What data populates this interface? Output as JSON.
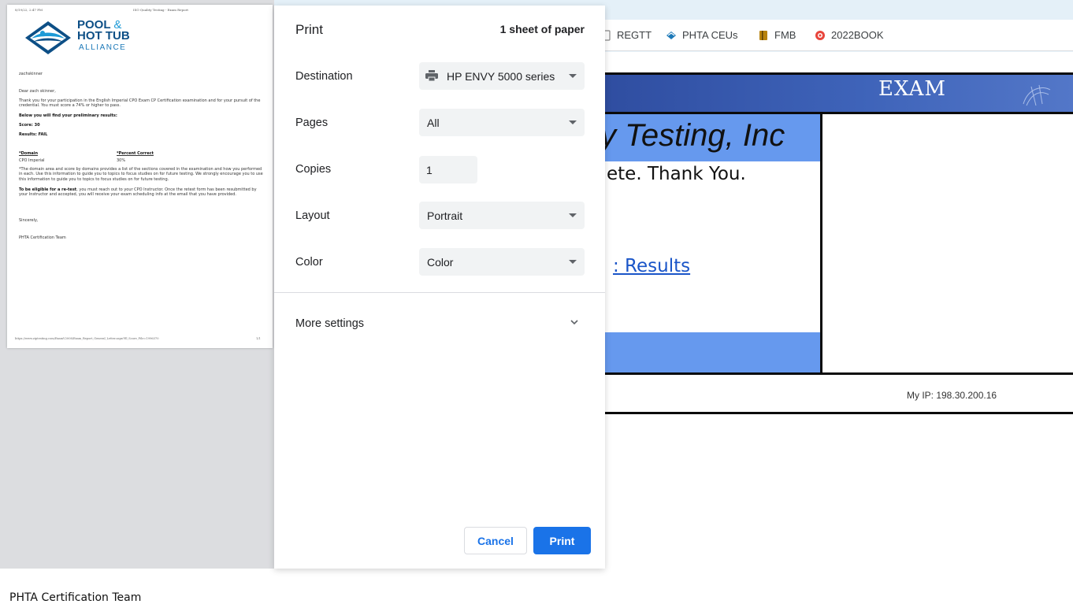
{
  "bookmarks": [
    {
      "label": "REGTT",
      "icon": "document-icon"
    },
    {
      "label": "PHTA CEUs",
      "icon": "phta-logo-icon"
    },
    {
      "label": "FMB",
      "icon": "book-icon"
    },
    {
      "label": "2022BOOK",
      "icon": "circle-logo-icon"
    }
  ],
  "background_page": {
    "exam_header": "EXAM",
    "testing_text": "y Testing, Inc",
    "thanks_text": "ete. Thank You.",
    "results_link": ": Results",
    "my_ip": "My IP: 198.30.200.16"
  },
  "print_dialog": {
    "title": "Print",
    "sheets": "1 sheet of paper",
    "destination": {
      "label": "Destination",
      "value": "HP ENVY 5000 series"
    },
    "pages": {
      "label": "Pages",
      "value": "All"
    },
    "copies": {
      "label": "Copies",
      "value": "1"
    },
    "layout": {
      "label": "Layout",
      "value": "Portrait"
    },
    "color": {
      "label": "Color",
      "value": "Color"
    },
    "more_settings": "More settings",
    "cancel_label": "Cancel",
    "print_label": "Print"
  },
  "preview_doc": {
    "header_left": "8/19/22, 2:47 PM",
    "header_center": "ISO Quality Testing - Exam Report",
    "logo": {
      "line1": "POOL",
      "amp": "&",
      "line2": "HOT TUB",
      "line3": "ALLIANCE"
    },
    "username": "zachskinner",
    "greeting": "Dear zach skinner,",
    "intro": "Thank you for your participation in the English Imperial CPO Exam CP Certification examination and for your pursuit of the credential. You must score a 74% or higher to pass.",
    "below": "Below you will find your preliminary results:",
    "score": "Score: 30",
    "results": "Results: FAIL",
    "col_domain": "*Domain",
    "col_percent": "*Percent Correct",
    "row_domain": "CPO Imperial",
    "row_percent": "30%",
    "note": "*The domain area and score by domains provides a list of the sections covered in the examination and how you performed in each. Use this information to guide you to topics to focus studies on for future testing. We strongly encourage you to use this information to guide you to topics to focus studies on for future testing.",
    "retest_bold": "To be eligible for a re-test",
    "retest_rest": ", you must reach out to your CPO Instructor. Once the retest form has been resubmitted by your Instructor and accepted, you will receive your exam scheduling info at the email that you have provided.",
    "sincerely": "Sincerely,",
    "team": "PHTA Certification Team",
    "footer_url": "https://www.ziptesting.com/ExamV2008/Exam_Report_General_Letter.aspx?El_Score_File=1996370",
    "footer_page": "1/1"
  },
  "bottom_text": "PHTA Certification Team"
}
